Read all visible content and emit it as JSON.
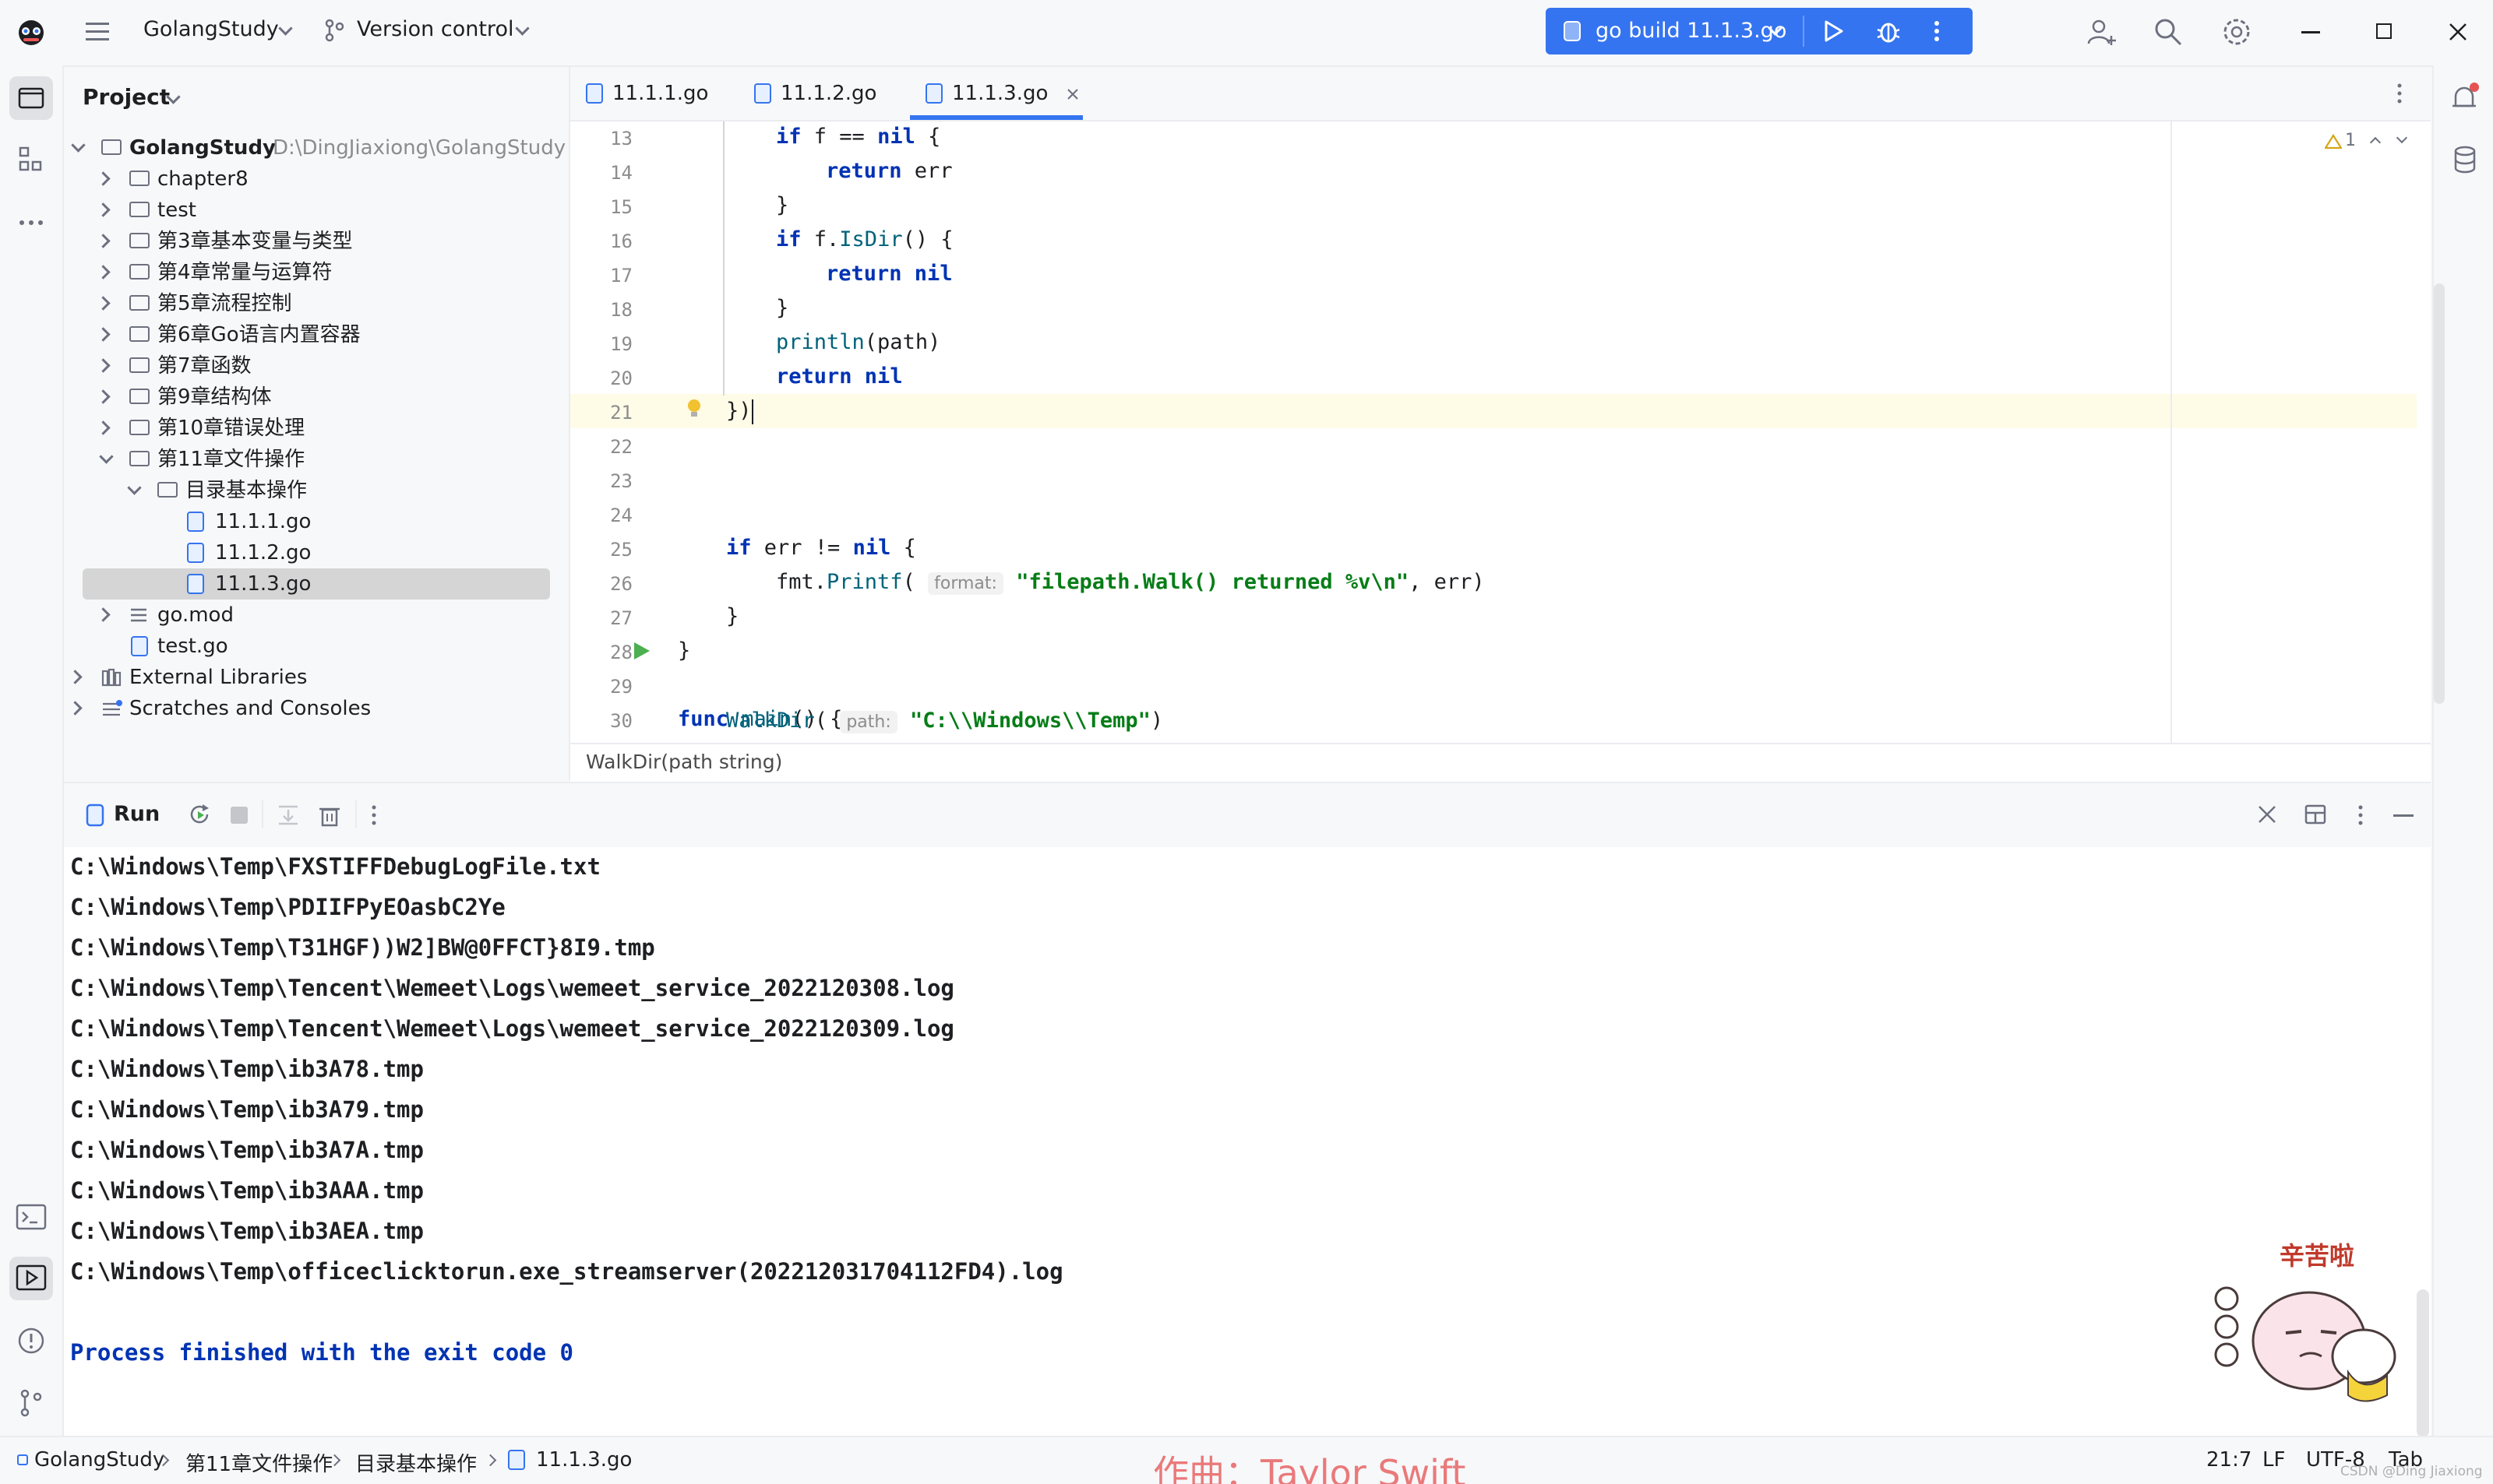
{
  "titlebar": {
    "project_name": "GolangStudy",
    "vcs_label": "Version control",
    "run_config": "go build 11.1.3.go"
  },
  "project_panel": {
    "title": "Project",
    "root": {
      "name": "GolangStudy",
      "path": "D:\\DingJiaxiong\\GolangStudy"
    },
    "items": [
      {
        "label": "chapter8"
      },
      {
        "label": "test"
      },
      {
        "label": "第3章基本变量与类型"
      },
      {
        "label": "第4章常量与运算符"
      },
      {
        "label": "第5章流程控制"
      },
      {
        "label": "第6章Go语言内置容器"
      },
      {
        "label": "第7章函数"
      },
      {
        "label": "第9章结构体"
      },
      {
        "label": "第10章错误处理"
      },
      {
        "label": "第11章文件操作"
      },
      {
        "label": "目录基本操作"
      },
      {
        "label": "11.1.1.go"
      },
      {
        "label": "11.1.2.go"
      },
      {
        "label": "11.1.3.go"
      },
      {
        "label": "go.mod"
      },
      {
        "label": "test.go"
      },
      {
        "label": "External Libraries"
      },
      {
        "label": "Scratches and Consoles"
      }
    ]
  },
  "editor": {
    "tabs": [
      {
        "label": "11.1.1.go"
      },
      {
        "label": "11.1.2.go"
      },
      {
        "label": "11.1.3.go"
      }
    ],
    "active_tab": "11.1.3.go",
    "warnings": "1",
    "line_numbers": [
      "13",
      "14",
      "15",
      "16",
      "17",
      "18",
      "19",
      "20",
      "21",
      "22",
      "23",
      "24",
      "25",
      "26",
      "27",
      "28",
      "29",
      "30"
    ],
    "code": {
      "l13_kw": "if",
      "l13_rest": " f == ",
      "l13_nil": "nil",
      "l13_end": " {",
      "l14_kw": "return",
      "l14_rest": " err",
      "l15": "}",
      "l16_kw": "if",
      "l16_a": " f.",
      "l16_fn": "IsDir",
      "l16_b": "() {",
      "l17_kw": "return",
      "l17_nil": " nil",
      "l18": "}",
      "l19_fn": "println",
      "l19_rest": "(path)",
      "l20_kw": "return",
      "l20_nil": " nil",
      "l21": "})",
      "l23_kw": "if",
      "l23_rest": " err != ",
      "l23_nil": "nil",
      "l23_end": " {",
      "l24_pkg": "fmt.",
      "l24_fn": "Printf",
      "l24_open": "(",
      "l24_hint": "format:",
      "l24_str": "\"filepath.Walk() returned %v\\n\"",
      "l24_end": ", err)",
      "l25": "}",
      "l26": "}",
      "l28_kw": "func",
      "l28_fn": " main",
      "l28_end": "() {",
      "l30_fn": "WalkDir",
      "l30_open": "(",
      "l30_hint": "path:",
      "l30_str": "\"C:\\\\Windows\\\\Temp\"",
      "l30_end": ")"
    },
    "breadcrumb": "WalkDir(path string)"
  },
  "run_panel": {
    "title": "Run",
    "output": [
      "C:\\Windows\\Temp\\FXSTIFFDebugLogFile.txt",
      "C:\\Windows\\Temp\\PDIIFPyEOasbC2Ye",
      "C:\\Windows\\Temp\\T31HGF))W2]BW@0FFCT}8I9.tmp",
      "C:\\Windows\\Temp\\Tencent\\Wemeet\\Logs\\wemeet_service_2022120308.log",
      "C:\\Windows\\Temp\\Tencent\\Wemeet\\Logs\\wemeet_service_2022120309.log",
      "C:\\Windows\\Temp\\ib3A78.tmp",
      "C:\\Windows\\Temp\\ib3A79.tmp",
      "C:\\Windows\\Temp\\ib3A7A.tmp",
      "C:\\Windows\\Temp\\ib3AAA.tmp",
      "C:\\Windows\\Temp\\ib3AEA.tmp",
      "C:\\Windows\\Temp\\officeclicktorun.exe_streamserver(202212031704112FD4).log"
    ],
    "finished": "Process finished with the exit code 0",
    "sticker_text": "辛苦啦"
  },
  "statusbar": {
    "crumbs": [
      "GolangStudy",
      "第11章文件操作",
      "目录基本操作",
      "11.1.3.go"
    ],
    "position": "21:7",
    "line_sep": "LF",
    "encoding": "UTF-8",
    "indent": "Tab",
    "watermark": "CSDN @Ding Jiaxiong",
    "overlay_text": "作曲：Taylor Swift"
  },
  "colors": {
    "accent": "#3574f0",
    "keyword": "#0033b3",
    "string": "#067d17",
    "function": "#00627a"
  }
}
